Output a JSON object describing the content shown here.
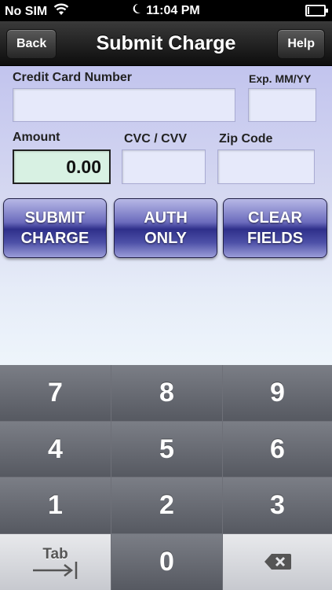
{
  "status": {
    "carrier": "No SIM",
    "time": "11:04 PM",
    "battery_level": 0.1
  },
  "nav": {
    "back_label": "Back",
    "title": "Submit Charge",
    "help_label": "Help"
  },
  "form": {
    "card_label": "Credit Card Number",
    "card_value": "",
    "exp_label": "Exp. MM/YY",
    "exp_value": "",
    "amount_label": "Amount",
    "amount_value": "0.00",
    "cvc_label": "CVC / CVV",
    "cvc_value": "",
    "zip_label": "Zip Code",
    "zip_value": ""
  },
  "actions": [
    {
      "line1": "SUBMIT",
      "line2": "CHARGE"
    },
    {
      "line1": "AUTH",
      "line2": "ONLY"
    },
    {
      "line1": "CLEAR",
      "line2": "FIELDS"
    }
  ],
  "keypad": {
    "keys": [
      "7",
      "8",
      "9",
      "4",
      "5",
      "6",
      "1",
      "2",
      "3"
    ],
    "tab_label": "Tab",
    "zero": "0"
  },
  "colors": {
    "amount_field": "#d8f1e3",
    "action_button": "#2e2f8a"
  }
}
